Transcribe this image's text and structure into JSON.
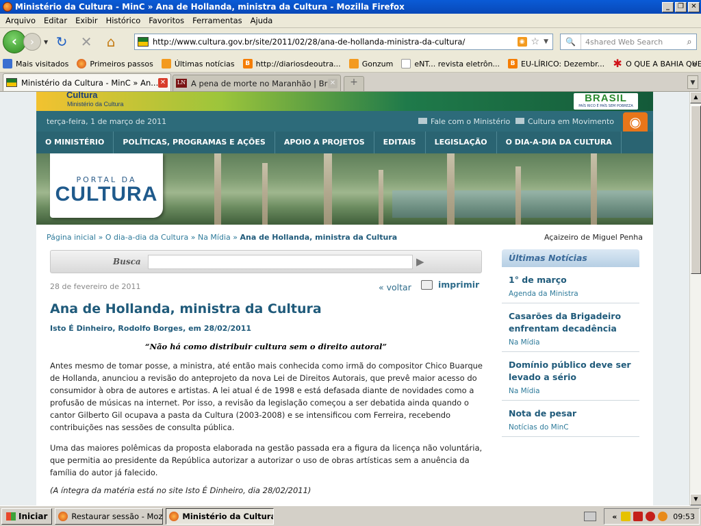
{
  "window": {
    "title": "Ministério da Cultura - MinC » Ana de Hollanda, ministra da Cultura - Mozilla Firefox"
  },
  "menubar": [
    "Arquivo",
    "Editar",
    "Exibir",
    "Histórico",
    "Favoritos",
    "Ferramentas",
    "Ajuda"
  ],
  "navigation": {
    "url": "http://www.cultura.gov.br/site/2011/02/28/ana-de-hollanda-ministra-da-cultura/",
    "search_placeholder": "4shared Web Search"
  },
  "bookmarks": [
    {
      "label": "Mais visitados",
      "icon": "bookmark-folder-icon"
    },
    {
      "label": "Primeiros passos",
      "icon": "firefox-icon"
    },
    {
      "label": "Últimas notícias",
      "icon": "rss-icon"
    },
    {
      "label": "http://diariosdeoutra...",
      "icon": "blogger-icon"
    },
    {
      "label": "Gonzum",
      "icon": "rss-icon"
    },
    {
      "label": "eNT... revista eletrôn...",
      "icon": "page-icon"
    },
    {
      "label": "EU-LÍRICO: Dezembr...",
      "icon": "blogger-icon"
    },
    {
      "label": "O QUE A BAHIA QUE...",
      "icon": "star-icon"
    }
  ],
  "tabs": [
    {
      "label": "Ministério da Cultura - MinC » An...",
      "active": true
    },
    {
      "label": "A pena de morte no Maranhão | Brasilia...",
      "active": false
    }
  ],
  "site": {
    "logo_title": "Cultura",
    "logo_subtitle": "Ministério da Cultura",
    "brasil_label": "BRASIL",
    "brasil_tagline": "PAÍS RICO É PAÍS SEM POBREZA",
    "date": "terça-feira, 1 de março de 2011",
    "contact_link": "Fale com o Ministério",
    "movement_link": "Cultura em Movimento",
    "nav": [
      "O MINISTÉRIO",
      "POLÍTICAS, PROGRAMAS E AÇÕES",
      "APOIO A PROJETOS",
      "EDITAIS",
      "LEGISLAÇÃO",
      "O DIA-A-DIA DA CULTURA"
    ],
    "portal_line1": "PORTAL DA",
    "portal_line2": "CULTURA"
  },
  "breadcrumb": {
    "home": "Página inicial",
    "section": "O dia-a-dia da Cultura",
    "subsection": "Na Mídia",
    "current": "Ana de Hollanda, ministra da Cultura",
    "separator": "»"
  },
  "photo_credit": "Açaizeiro de Miguel Penha",
  "search": {
    "label": "Busca"
  },
  "article": {
    "date": "28 de fevereiro de 2011",
    "back": "« voltar",
    "print": "imprimir",
    "title": "Ana de Hollanda, ministra da Cultura",
    "byline": "Isto É Dinheiro, Rodolfo Borges, em 28/02/2011",
    "quote": "“Não há como distribuir cultura sem o direito autoral”",
    "paragraph1": "Antes mesmo de tomar posse, a ministra, até então mais conhecida como irmã do compositor Chico Buarque de Hollanda, anunciou a revisão do anteprojeto da nova Lei de Direitos Autorais, que prevê maior acesso do consumidor à obra de autores e artistas. A lei atual é de 1998 e está defasada diante de novidades como a profusão de músicas na internet. Por isso, a revisão da legislação começou a ser debatida ainda quando o cantor Gilberto Gil ocupava a pasta da Cultura (2003-2008) e se intensificou com Ferreira, recebendo contribuições nas sessões de consulta pública.",
    "paragraph2": " Uma das maiores polêmicas da proposta elaborada na gestão passada era a figura da licença não voluntária, que permitia ao presidente da República autorizar a autorizar o uso de obras artísticas sem a anuência da família do autor já falecido.",
    "paragraph3": "(A íntegra da matéria está no site Isto É Dinheiro, dia 28/02/2011)"
  },
  "sidebar": {
    "title": "Últimas Notícias",
    "items": [
      {
        "title": "1° de março",
        "category": "Agenda da Ministra"
      },
      {
        "title": "Casarões da Brigadeiro enfrentam decadência",
        "category": "Na Mídia"
      },
      {
        "title": "Domínio público deve ser levado a sério",
        "category": "Na Mídia"
      },
      {
        "title": "Nota de pesar",
        "category": "Notícias do MinC"
      }
    ]
  },
  "taskbar": {
    "start": "Iniciar",
    "items": [
      {
        "label": "Restaurar sessão - Mozill...",
        "pressed": false
      },
      {
        "label": "Ministério da Cultura ...",
        "pressed": true
      }
    ],
    "tray_arrow": "«",
    "clock": "09:53"
  }
}
